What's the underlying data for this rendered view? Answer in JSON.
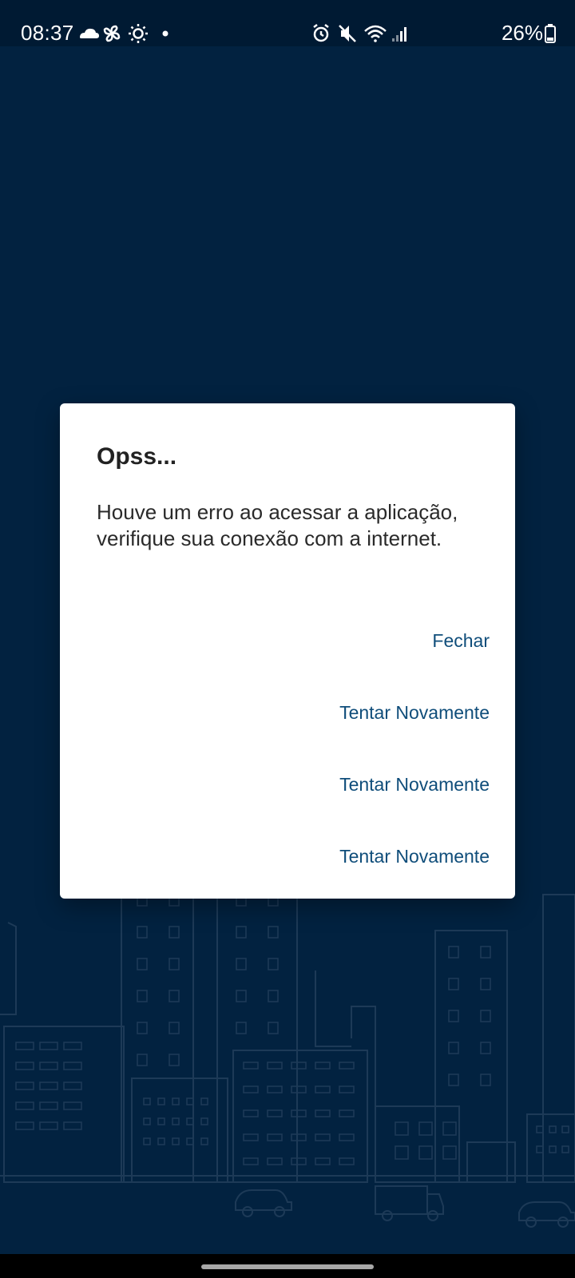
{
  "status_bar": {
    "time": "08:37",
    "battery": "26%",
    "left_icons": [
      "cloud-icon",
      "pinwheel-icon",
      "brightness-icon",
      "notification-dot-icon"
    ],
    "right_icons": [
      "alarm-icon",
      "mute-icon",
      "wifi-icon",
      "signal-icon",
      "battery-icon"
    ]
  },
  "dialog": {
    "title": "Opss...",
    "message": "Houve um erro ao acessar a aplicação, verifique sua conexão com a internet.",
    "actions": [
      {
        "label": "Fechar"
      },
      {
        "label": "Tentar Novamente"
      },
      {
        "label": "Tentar Novamente"
      },
      {
        "label": "Tentar Novamente"
      }
    ]
  },
  "colors": {
    "background": "#022240",
    "dialog_action": "#0f4d7a",
    "skyline_stroke": "#1d3a57"
  }
}
